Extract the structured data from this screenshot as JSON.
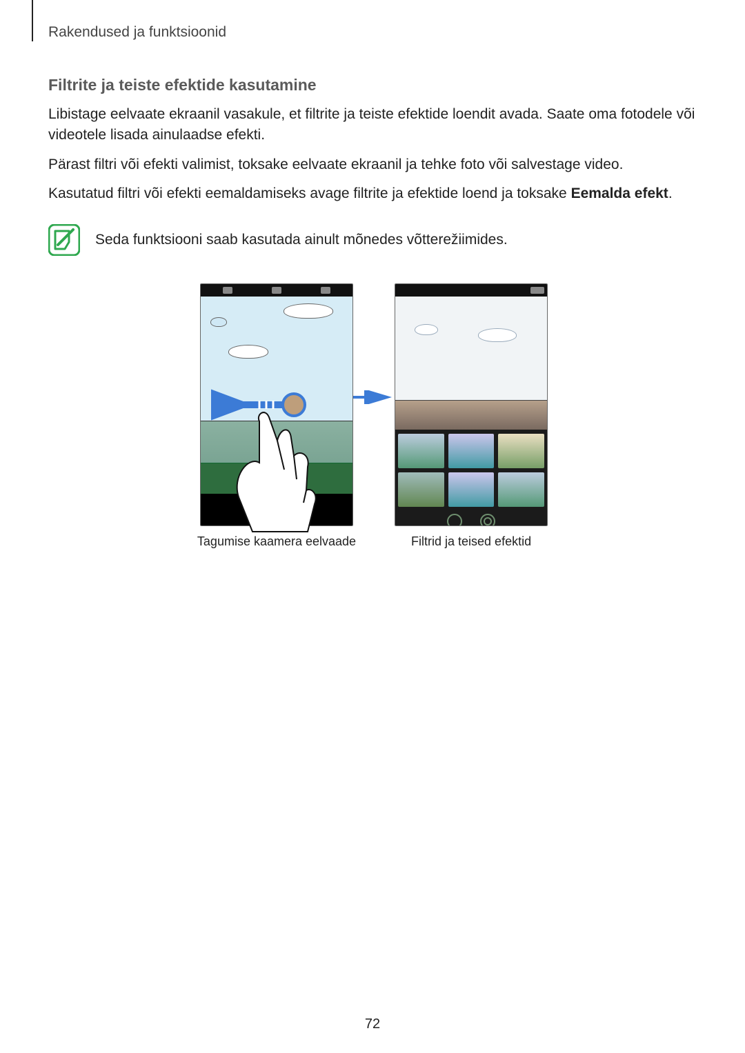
{
  "header": {
    "section_title": "Rakendused ja funktsioonid"
  },
  "section": {
    "heading": "Filtrite ja teiste efektide kasutamine",
    "para1": "Libistage eelvaate ekraanil vasakule, et filtrite ja teiste efektide loendit avada. Saate oma fotodele või videotele lisada ainulaadse efekti.",
    "para2": "Pärast filtri või efekti valimist, toksake eelvaate ekraanil ja tehke foto või salvestage video.",
    "para3_pre": "Kasutatud filtri või efekti eemaldamiseks avage filtrite ja efektide loend ja toksake ",
    "para3_bold": "Eemalda efekt",
    "para3_post": "."
  },
  "note": {
    "text": "Seda funktsiooni saab kasutada ainult mõnedes võtterežiimides."
  },
  "figures": {
    "left_caption": "Tagumise kaamera eelvaade",
    "right_caption": "Filtrid ja teised efektid"
  },
  "page_number": "72"
}
